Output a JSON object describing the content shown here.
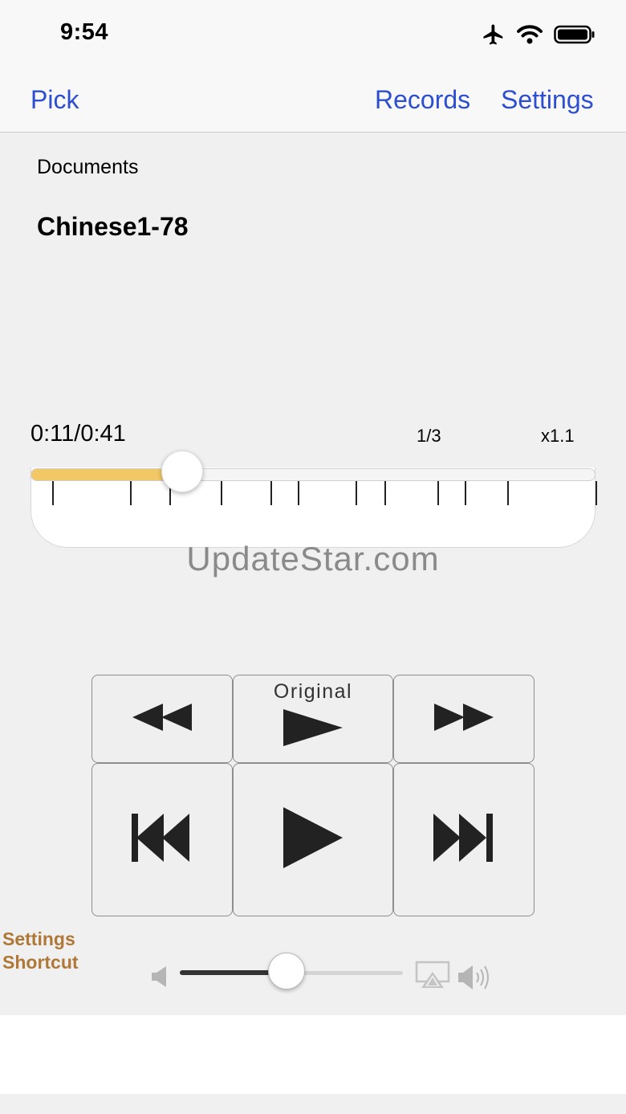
{
  "status_bar": {
    "time": "9:54",
    "icons": [
      "airplane-icon",
      "wifi-icon",
      "battery-icon"
    ]
  },
  "nav": {
    "pick": "Pick",
    "records": "Records",
    "settings": "Settings",
    "accent_color": "#2d4fcf"
  },
  "player": {
    "folder": "Documents",
    "title": "Chinese1-78",
    "time": "0:11/0:41",
    "segment": "1/3",
    "speed": "x1.1",
    "progress_fraction": 0.268,
    "progress_color": "#f2c866",
    "segment_markers_seconds": [
      1.6,
      7.2,
      10.1,
      13.8,
      17.4,
      19.4,
      23.6,
      25.7,
      29.5,
      31.5,
      34.6,
      41.0
    ]
  },
  "watermark": "UpdateStar.com",
  "controls": {
    "original_label": "Original",
    "buttons": [
      "rewind",
      "play-original",
      "fast-forward",
      "skip-back",
      "play",
      "skip-forward"
    ]
  },
  "shortcut": {
    "line1": "Settings",
    "line2": "Shortcut",
    "color": "#b07838"
  },
  "volume": {
    "level": 0.48,
    "icons": [
      "speaker-low-icon",
      "airplay-icon",
      "speaker-high-icon"
    ]
  }
}
